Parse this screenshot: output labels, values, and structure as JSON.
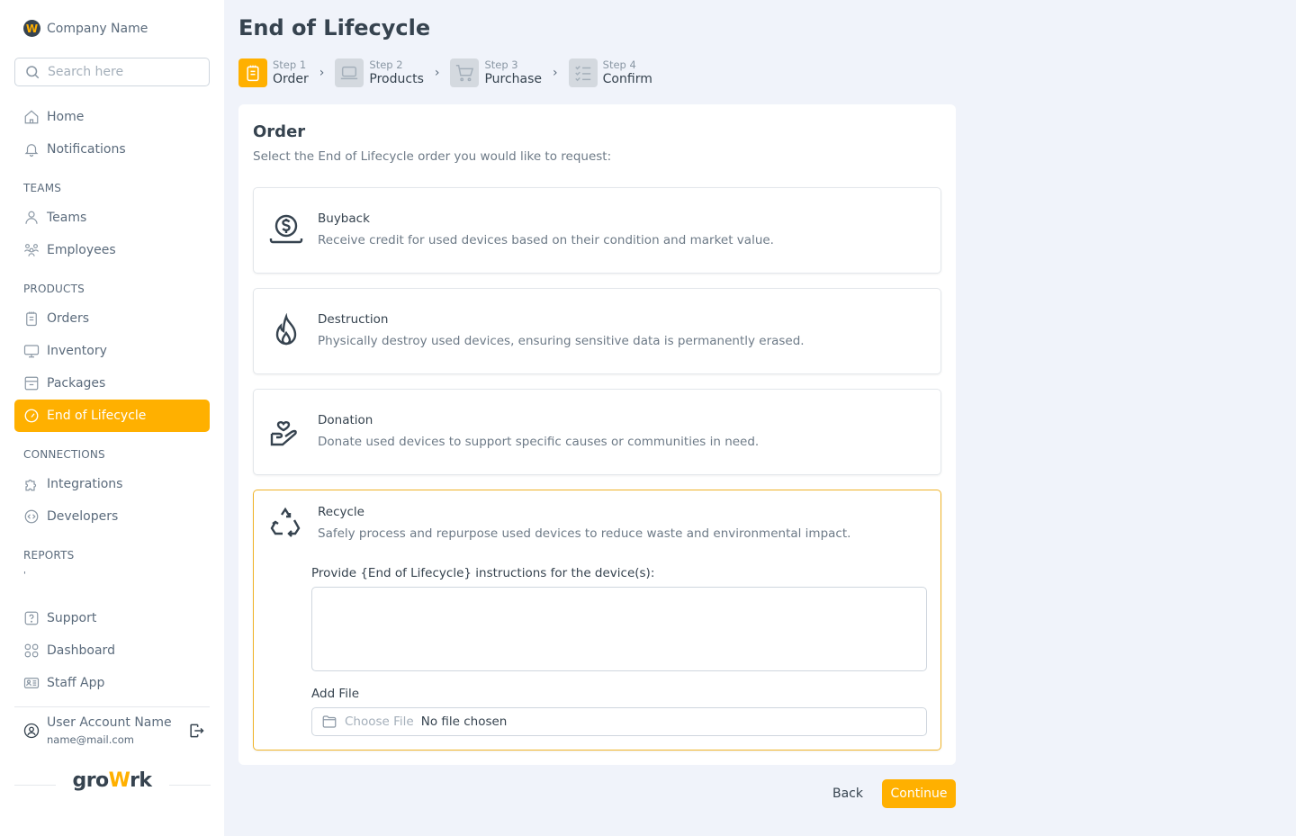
{
  "sidebar": {
    "company": {
      "logo_letter": "W",
      "name": "Company Name"
    },
    "search": {
      "placeholder": "Search here",
      "value": ""
    },
    "top_items": [
      {
        "label": "Home",
        "icon": "home-icon"
      },
      {
        "label": "Notifications",
        "icon": "bell-icon"
      }
    ],
    "sections": {
      "teams": "TEAMS",
      "products": "PRODUCTS",
      "connections": "CONNECTIONS",
      "reports": "REPORTS"
    },
    "teams_items": [
      {
        "label": "Teams",
        "icon": "user-icon"
      },
      {
        "label": "Employees",
        "icon": "users-icon"
      }
    ],
    "products_items": [
      {
        "label": "Orders",
        "icon": "clipboard-icon"
      },
      {
        "label": "Inventory",
        "icon": "monitor-icon"
      },
      {
        "label": "Packages",
        "icon": "archive-icon"
      },
      {
        "label": "End of Lifecycle",
        "icon": "gauge-icon",
        "active": true
      }
    ],
    "connections_items": [
      {
        "label": "Integrations",
        "icon": "puzzle-icon"
      },
      {
        "label": "Developers",
        "icon": "code-icon"
      }
    ],
    "reports_placeholder": "'",
    "bottom_items": [
      {
        "label": "Support",
        "icon": "help-icon"
      },
      {
        "label": "Dashboard",
        "icon": "grid-icon"
      },
      {
        "label": "Staff App",
        "icon": "id-card-icon"
      }
    ],
    "user": {
      "name": "User Account Name",
      "email": "name@mail.com"
    },
    "brand": {
      "prefix": "gro",
      "accent": "W",
      "suffix": "rk"
    }
  },
  "header": {
    "title": "End of Lifecycle"
  },
  "steps": [
    {
      "small": "Step 1",
      "label": "Order",
      "active": true
    },
    {
      "small": "Step 2",
      "label": "Products"
    },
    {
      "small": "Step 3",
      "label": "Purchase"
    },
    {
      "small": "Step 4",
      "label": "Confirm"
    }
  ],
  "order": {
    "title": "Order",
    "subtitle": "Select the End of Lifecycle order you would like to request:",
    "options": [
      {
        "title": "Buyback",
        "desc": "Receive credit for used devices based on their condition and market value.",
        "icon": "money-hand-icon"
      },
      {
        "title": "Destruction",
        "desc": "Physically destroy used devices, ensuring sensitive data is permanently erased.",
        "icon": "flame-icon"
      },
      {
        "title": "Donation",
        "desc": "Donate used devices to support specific causes or communities in need.",
        "icon": "heart-hand-icon"
      },
      {
        "title": "Recycle",
        "desc": "Safely process and repurpose used devices to reduce waste and environmental impact.",
        "icon": "recycle-icon",
        "selected": true
      }
    ],
    "instructions_label": "Provide {End of Lifecycle} instructions for the device(s):",
    "instructions_value": "",
    "file_label": "Add File",
    "file_choose": "Choose File",
    "file_status": "No file chosen"
  },
  "actions": {
    "back": "Back",
    "continue": "Continue"
  },
  "colors": {
    "accent": "#ffb000",
    "text": "#36434f",
    "muted": "#5b6b7c",
    "background": "#f0f3fa"
  }
}
